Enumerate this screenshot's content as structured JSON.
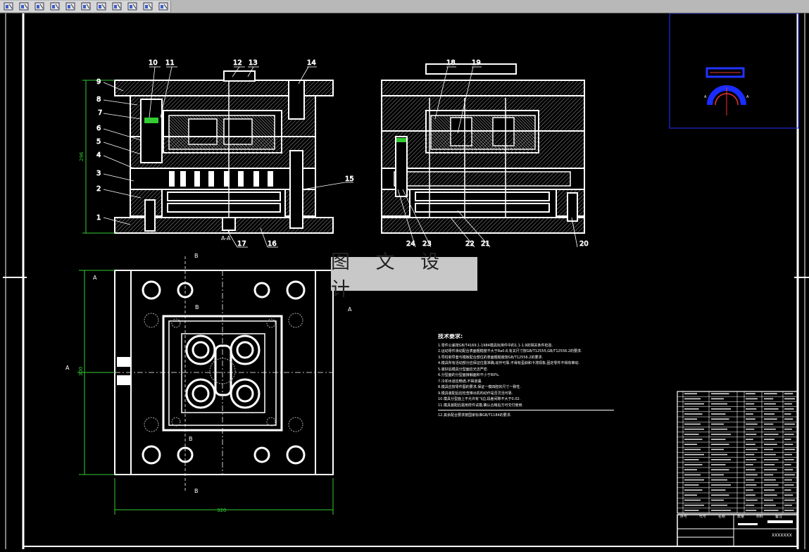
{
  "toolbar": {
    "buttons": [
      "draw-icon",
      "layer-icon",
      "align-icon",
      "grid-icon",
      "block-icon",
      "insert-icon",
      "table-icon",
      "properties-icon",
      "snap-icon",
      "dimension-icon",
      "text-icon"
    ]
  },
  "watermark": "图 文 设 计",
  "views": {
    "section_label": "A-A",
    "section_b": "B",
    "section_a": "A",
    "dim_height": "296",
    "dim_width": "320",
    "dim_plan_height": "300"
  },
  "balloons_left": [
    "1",
    "2",
    "3",
    "4",
    "5",
    "6",
    "7",
    "8",
    "9"
  ],
  "balloons_top": [
    "10",
    "11",
    "12",
    "13",
    "14"
  ],
  "balloons_right_side": [
    "15"
  ],
  "balloons_bottom": [
    "17",
    "16"
  ],
  "balloons_view2_top": [
    "18",
    "19"
  ],
  "balloons_view2_bottom": [
    "24",
    "23",
    "22",
    "21",
    "20"
  ],
  "notes": {
    "title": "技术要求:",
    "lines": [
      "1.零件公差按GB/T4169.1-1984模具标准件中的1.1-1.9的相关条件检验.",
      "2.运动零件滑动配合表面粗糙度不大于Ra0.8,有关尺寸按GB/T12555,GB/T12556.2的要求.",
      "3.导柱和导套与模板配合部位的表面粗糙度按GB/T12556.2的要求.",
      "4.模具所有活动部分应保证位置准确,动作可靠,不得有歪斜和卡滞现象,固定零件不得有窜动.",
      "5.装好后模具分型面应光洁严密.",
      "6.分型面的分型面接触面积不小于80%.",
      "7.冷却水道应畅通,不得渗漏.",
      "8.模具应按零件图的要求,保证一模四腔的尺寸一致性.",
      "9.模具装配后应检查推出机构动作是否灵活可靠.",
      "10.模具分型面上不允许有飞边,段差间隙不大于0.02.",
      "11.模具装配后需用样件试模,确认合格后方可交付使用.",
      "12.其余配合要求按国家标准GB/T1184的要求."
    ]
  },
  "title_block": {
    "drawing_no": "XXXXXXX",
    "scale_label": "比例",
    "header_cols": [
      "序号",
      "代号",
      "名称",
      "数量",
      "材料",
      "备注"
    ]
  }
}
